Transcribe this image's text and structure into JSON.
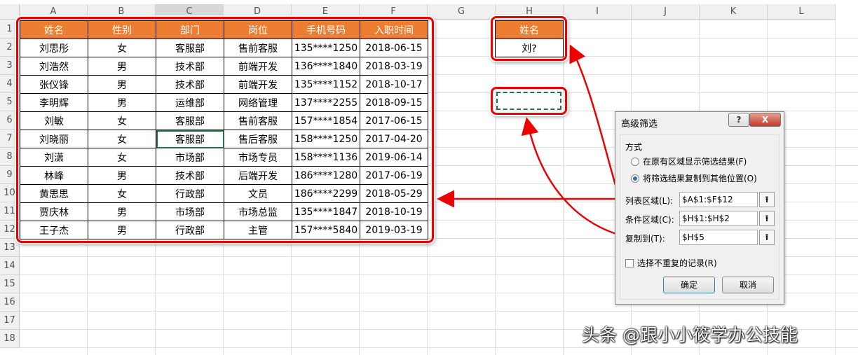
{
  "columns": [
    "A",
    "B",
    "C",
    "D",
    "E",
    "F",
    "G",
    "H",
    "I",
    "J",
    "K",
    "L"
  ],
  "rows": [
    "1",
    "2",
    "3",
    "4",
    "5",
    "6",
    "7",
    "8",
    "9",
    "10",
    "11",
    "12",
    "13",
    "14",
    "15",
    "16",
    "17",
    "18"
  ],
  "table": {
    "headers": [
      "姓名",
      "性别",
      "部门",
      "岗位",
      "手机号码",
      "入职时间"
    ],
    "rows": [
      [
        "刘思彤",
        "女",
        "客服部",
        "售前客服",
        "135****1250",
        "2018-06-15"
      ],
      [
        "刘浩然",
        "男",
        "技术部",
        "前端开发",
        "136****1840",
        "2018-03-19"
      ],
      [
        "张仪锋",
        "男",
        "技术部",
        "前端开发",
        "135****1152",
        "2018-10-17"
      ],
      [
        "李明辉",
        "男",
        "运维部",
        "网络管理",
        "137****2255",
        "2018-09-15"
      ],
      [
        "刘敏",
        "女",
        "客服部",
        "售前客服",
        "157****1854",
        "2017-06-15"
      ],
      [
        "刘晓丽",
        "女",
        "客服部",
        "售后客服",
        "158****1250",
        "2017-04-20"
      ],
      [
        "刘潇",
        "女",
        "市场部",
        "市场专员",
        "158****1136",
        "2019-06-14"
      ],
      [
        "林峰",
        "男",
        "技术部",
        "后端开发",
        "186****1280",
        "2017-06-19"
      ],
      [
        "黄思思",
        "女",
        "行政部",
        "文员",
        "186****2299",
        "2018-05-29"
      ],
      [
        "贾庆林",
        "男",
        "市场部",
        "市场总监",
        "135****1847",
        "2018-10-19"
      ],
      [
        "王子杰",
        "男",
        "行政部",
        "主管",
        "157****5840",
        "2019-03-19"
      ]
    ]
  },
  "criteria": {
    "header": "姓名",
    "value": "刘?"
  },
  "dialog": {
    "title": "高级筛选",
    "help": "?",
    "close": "X",
    "group_label": "方式",
    "radio1": "在原有区域显示筛选结果(F)",
    "radio2": "将筛选结果复制到其他位置(O)",
    "list_range_label": "列表区域(L):",
    "list_range_value": "$A$1:$F$12",
    "criteria_range_label": "条件区域(C):",
    "criteria_range_value": "$H$1:$H$2",
    "copy_to_label": "复制到(T):",
    "copy_to_value": "$H$5",
    "unique_label": "选择不重复的记录(R)",
    "ok": "确定",
    "cancel": "取消",
    "pick_icon": "⭱"
  },
  "watermark": "头条 @跟小小筱学办公技能",
  "colors": {
    "header_fill": "#ed7d31",
    "highlight": "#ee0000",
    "selection": "#217346"
  }
}
